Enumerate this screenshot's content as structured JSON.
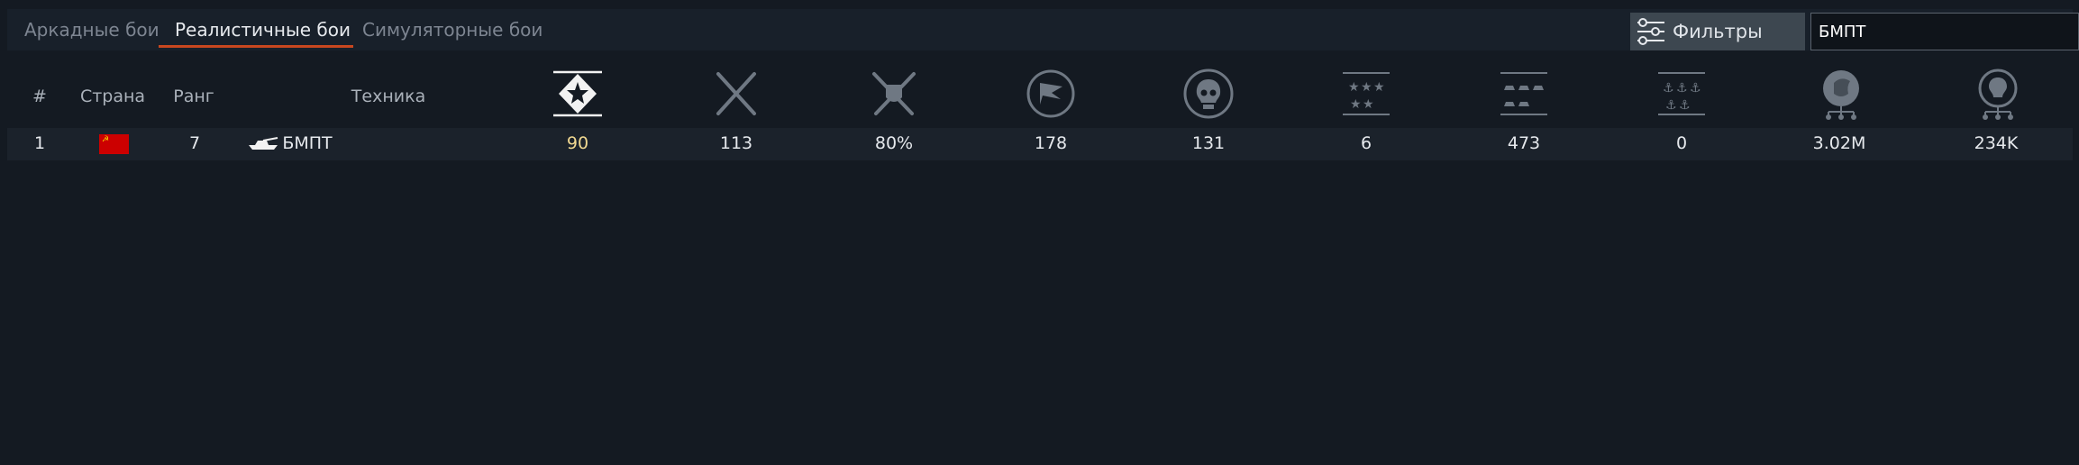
{
  "tabs": [
    {
      "label": "Аркадные бои",
      "active": false
    },
    {
      "label": "Реалистичные бои",
      "active": true
    },
    {
      "label": "Симуляторные бои",
      "active": false
    }
  ],
  "filters": {
    "label": "Фильтры",
    "icon": "sliders-icon"
  },
  "search": {
    "value": "БМПТ"
  },
  "columns": {
    "index": "#",
    "country": "Страна",
    "rank": "Ранг",
    "vehicle": "Техника",
    "stat_icons": [
      "rating-star-icon",
      "crossed-swords-icon",
      "swords-shield-icon",
      "flag-icon",
      "skull-icon",
      "stars-icon",
      "ground-units-icon",
      "naval-units-icon",
      "lion-icon",
      "lightbulb-icon"
    ]
  },
  "rows": [
    {
      "index": "1",
      "country_flag": "ussr-flag",
      "rank": "7",
      "vehicle_icon": "tank-icon",
      "vehicle": "БМПТ",
      "stats": [
        "90",
        "113",
        "80%",
        "178",
        "131",
        "6",
        "473",
        "0",
        "3.02M",
        "234K"
      ]
    }
  ],
  "colors": {
    "background": "#141a22",
    "accent": "#c8471f",
    "highlight_value": "#f0d891"
  }
}
